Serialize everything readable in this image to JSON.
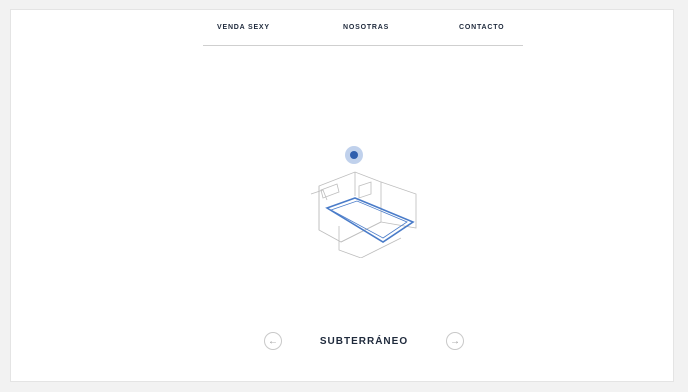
{
  "nav": {
    "items": [
      {
        "label": "VENDA SEXY"
      },
      {
        "label": "NOSOTRAS"
      },
      {
        "label": "CONTACTO"
      }
    ]
  },
  "illustration": {
    "icon": "floor-plan-isometric",
    "marker_icon": "location-dot-icon",
    "accent_color": "#4a7cc9"
  },
  "pager": {
    "title": "SUBTERRÁNEO",
    "prev_icon": "←",
    "next_icon": "→"
  }
}
